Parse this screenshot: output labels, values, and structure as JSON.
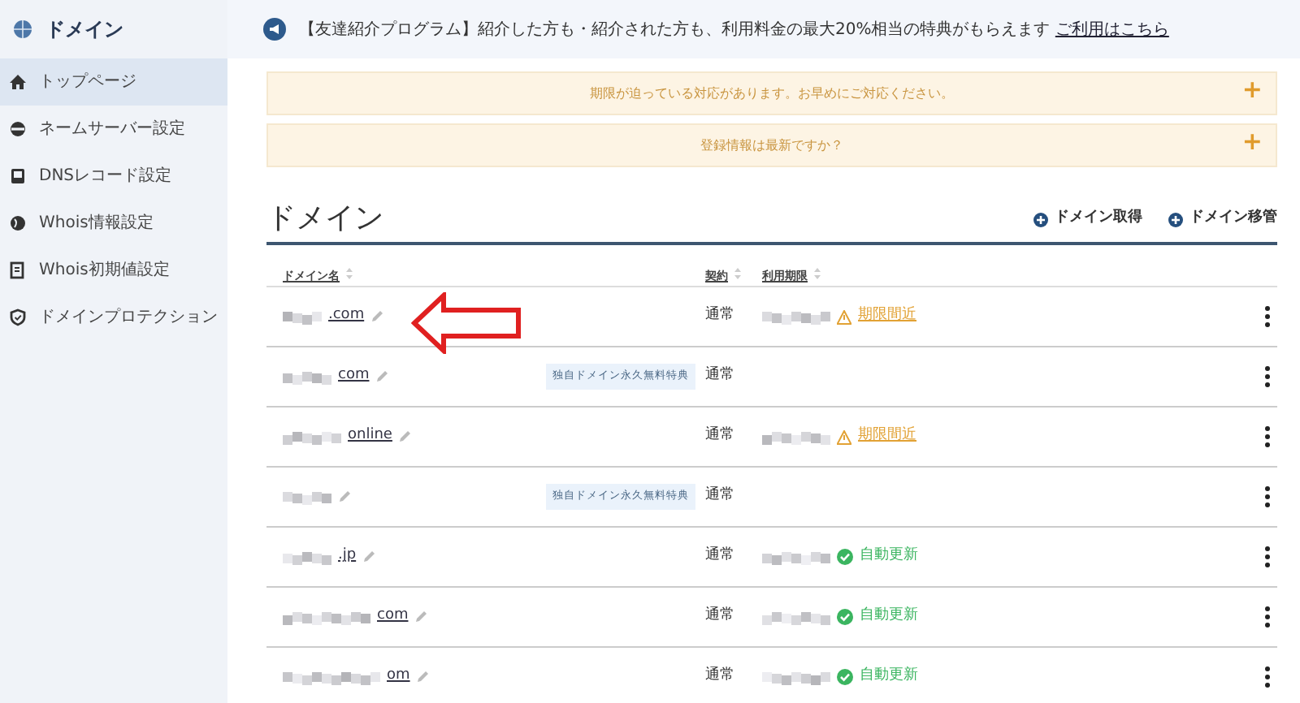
{
  "sidebar": {
    "title": "ドメイン",
    "items": [
      {
        "label": "トップページ",
        "selected": true
      },
      {
        "label": "ネームサーバー設定",
        "selected": false
      },
      {
        "label": "DNSレコード設定",
        "selected": false
      },
      {
        "label": "Whois情報設定",
        "selected": false
      },
      {
        "label": "Whois初期値設定",
        "selected": false
      },
      {
        "label": "ドメインプロテクション",
        "selected": false
      }
    ]
  },
  "announcement": {
    "text": "【友達紹介プログラム】紹介した方も・紹介された方も、利用料金の最大20%相当の特典がもらえます",
    "link": "ご利用はこちら"
  },
  "alerts": [
    {
      "text": "期限が迫っている対応があります。お早めにご対応ください。",
      "toggle": "+"
    },
    {
      "text": "登録情報は最新ですか？",
      "toggle": "+"
    }
  ],
  "heading": "ドメイン",
  "actions": [
    "ドメイン取得",
    "ドメイン移管"
  ],
  "table": {
    "columns": [
      "ドメイン名",
      "契約",
      "利用期限"
    ],
    "rows": [
      {
        "domain": ".com",
        "badge": null,
        "contract": "通常",
        "status": {
          "kind": "warning",
          "text": "期限間近"
        }
      },
      {
        "domain": "com",
        "badge": "独自ドメイン永久無料特典",
        "contract": "通常",
        "status": null
      },
      {
        "domain": "online",
        "badge": null,
        "contract": "通常",
        "status": {
          "kind": "warning",
          "text": "期限間近"
        }
      },
      {
        "domain": null,
        "badge": "独自ドメイン永久無料特典",
        "contract": "通常",
        "status": null
      },
      {
        "domain": ".jp",
        "badge": null,
        "contract": "通常",
        "status": {
          "kind": "auto",
          "text": "自動更新"
        }
      },
      {
        "domain": "com",
        "badge": null,
        "contract": "通常",
        "status": {
          "kind": "auto",
          "text": "自動更新"
        }
      },
      {
        "domain": "om",
        "badge": null,
        "contract": "通常",
        "status": {
          "kind": "auto",
          "text": "自動更新"
        }
      }
    ]
  }
}
